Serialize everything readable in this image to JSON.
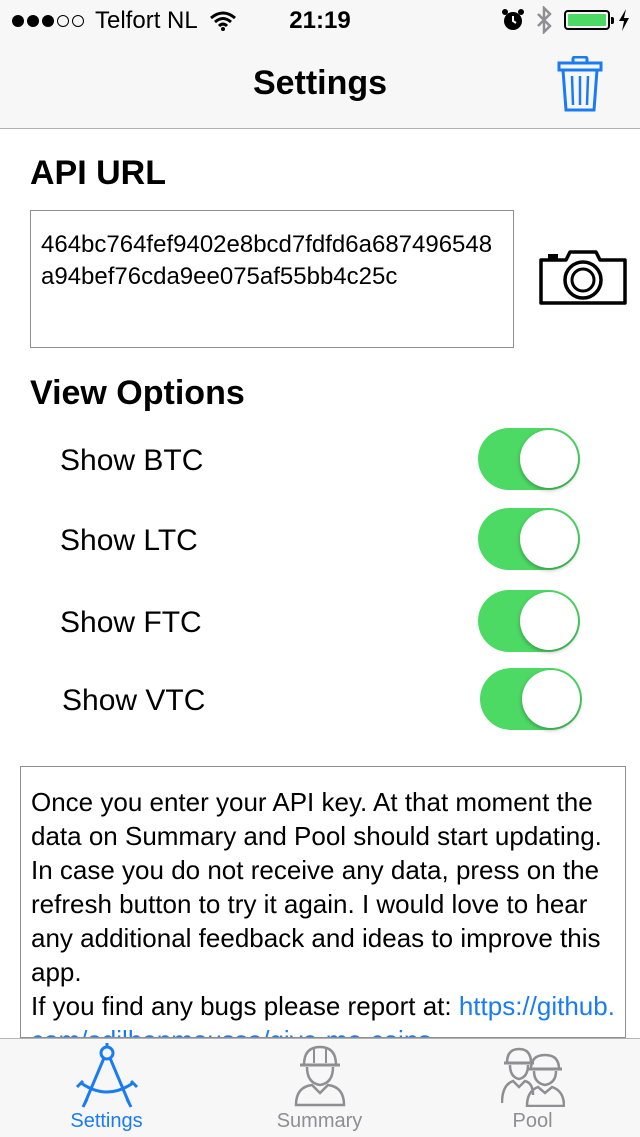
{
  "status_bar": {
    "carrier": "Telfort NL",
    "time": "21:19"
  },
  "nav": {
    "title": "Settings"
  },
  "api": {
    "heading": "API URL",
    "value": "464bc764fef9402e8bcd7fdfd6a687496548a94bef76cda9ee075af55bb4c25c"
  },
  "view_options": {
    "heading": "View Options",
    "items": [
      {
        "label": "Show BTC",
        "on": true
      },
      {
        "label": "Show LTC",
        "on": true
      },
      {
        "label": "Show FTC",
        "on": true
      },
      {
        "label": "Show VTC",
        "on": true
      }
    ]
  },
  "info": {
    "text": "Once you enter your API key. At that moment the data on Summary and Pool should start updating. In case you do not receive any data, press on the refresh button to try it again. I would love to hear any additional feedback and ideas to improve this app.",
    "bugs_text": "If you find any bugs please report at: ",
    "link": "https://github.com/adilbenmoussa/give-me-coins-"
  },
  "tabs": [
    {
      "label": "Settings",
      "active": true
    },
    {
      "label": "Summary",
      "active": false
    },
    {
      "label": "Pool",
      "active": false
    }
  ],
  "colors": {
    "accent": "#1a7cf4",
    "toggle_on": "#4cd964",
    "inactive": "#8e8e93"
  },
  "icons": {
    "trash": "trash-icon",
    "camera": "camera-icon",
    "settings_tab": "compass-icon",
    "summary_tab": "worker-icon",
    "pool_tab": "workers-group-icon"
  }
}
